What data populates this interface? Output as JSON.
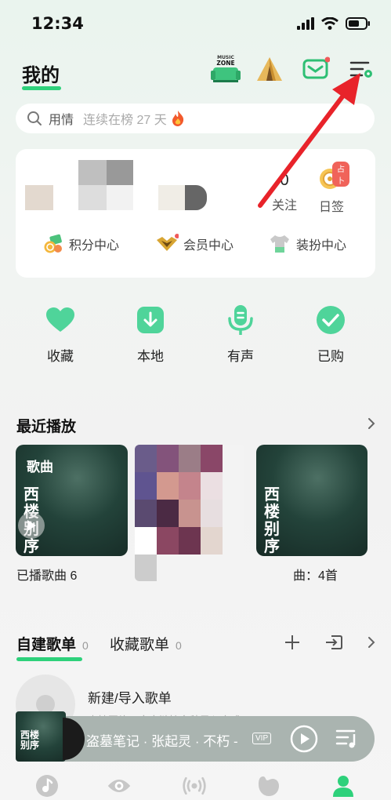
{
  "status": {
    "time": "12:34"
  },
  "header": {
    "title": "我的",
    "music_zone_label": "MUSIC ZONE"
  },
  "search": {
    "keyword": "用情",
    "hint": "连续在榜 27 天"
  },
  "profile": {
    "follow_count": "0",
    "follow_label": "关注",
    "checkin_label": "日签",
    "checkin_badge": "占卜",
    "shortcuts": [
      {
        "label": "积分中心",
        "icon": "coins-icon"
      },
      {
        "label": "会员中心",
        "icon": "vip-crown-icon"
      },
      {
        "label": "装扮中心",
        "icon": "tshirt-icon"
      }
    ]
  },
  "quick_actions": [
    {
      "label": "收藏",
      "icon": "heart-icon"
    },
    {
      "label": "本地",
      "icon": "download-icon"
    },
    {
      "label": "有声",
      "icon": "microphone-icon"
    },
    {
      "label": "已购",
      "icon": "check-icon"
    }
  ],
  "recent": {
    "title": "最近播放",
    "cards": [
      {
        "overlay": "歌曲",
        "album_text": "西楼别序",
        "caption": "已播歌曲 6"
      },
      {
        "overlay": "",
        "album_text": "",
        "caption": ""
      },
      {
        "overlay": "",
        "album_text": "西楼别序",
        "caption": "曲：4首"
      }
    ]
  },
  "playlists": {
    "tabs": [
      {
        "label": "自建歌单",
        "count": "0"
      },
      {
        "label": "收藏歌单",
        "count": "0"
      }
    ],
    "new_label": "新建/导入歌单",
    "new_sub": "支持图片、文字链接多种导入方式"
  },
  "player": {
    "track": "盗墓笔记 · 张起灵 · 不朽 -",
    "vip": "VIP",
    "cover_text": "西楼别序"
  },
  "nav": [
    {
      "icon": "music-note-icon"
    },
    {
      "icon": "eye-icon"
    },
    {
      "icon": "broadcast-icon"
    },
    {
      "icon": "community-icon"
    },
    {
      "icon": "profile-icon"
    }
  ],
  "colors": {
    "accent": "#2ed17b",
    "arrow": "#e8232a"
  }
}
